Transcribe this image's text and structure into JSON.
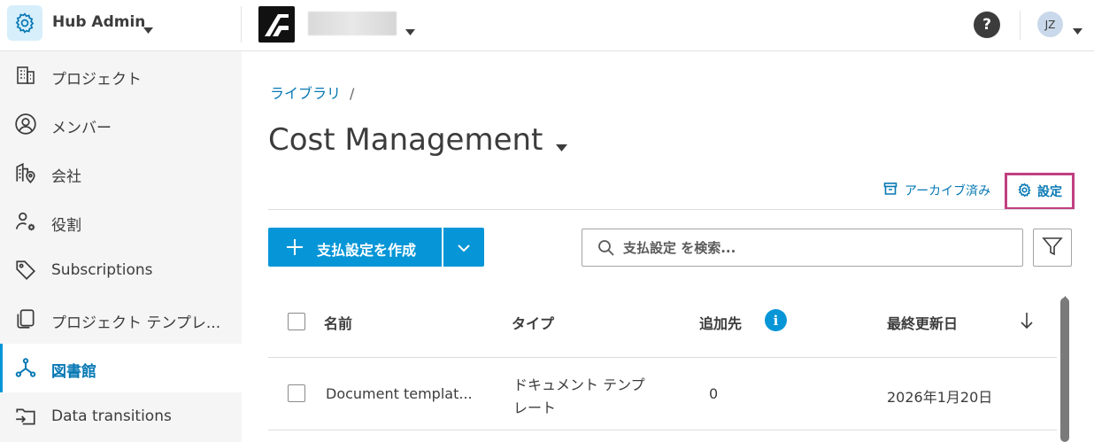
{
  "header": {
    "app_title": "Hub Admin",
    "help_label": "?",
    "avatar_initials": "JZ"
  },
  "sidebar": {
    "items": [
      {
        "label": "プロジェクト",
        "icon": "building-icon",
        "active": false
      },
      {
        "label": "メンバー",
        "icon": "user-circle-icon",
        "active": false
      },
      {
        "label": "会社",
        "icon": "company-location-icon",
        "active": false
      },
      {
        "label": "役割",
        "icon": "user-gear-icon",
        "active": false
      },
      {
        "label": "Subscriptions",
        "icon": "tag-icon",
        "active": false
      },
      {
        "label": "プロジェクト テンプレ...",
        "icon": "copy-icon",
        "active": false
      },
      {
        "label": "図書館",
        "icon": "network-icon",
        "active": true
      },
      {
        "label": "Data transitions",
        "icon": "folder-transfer-icon",
        "active": false
      }
    ]
  },
  "main": {
    "breadcrumb": {
      "link": "ライブラリ",
      "separator": "/"
    },
    "title": "Cost Management",
    "archive_label": "アーカイブ済み",
    "settings_label": "設定",
    "create_label": "支払設定を作成",
    "search_placeholder": "支払設定 を検索...",
    "table": {
      "headers": {
        "name": "名前",
        "type": "タイプ",
        "added_to": "追加先",
        "updated": "最終更新日"
      },
      "rows": [
        {
          "name": "Document templat...",
          "type_line1": "ドキュメント テンプ",
          "type_line2": "レート",
          "added_to": "0",
          "updated": "2026年1月20日"
        }
      ]
    }
  },
  "colors": {
    "accent": "#0696d7",
    "link": "#0678b4",
    "highlight_border": "#c0407f",
    "sidebar_bg": "#f5f5f5"
  }
}
